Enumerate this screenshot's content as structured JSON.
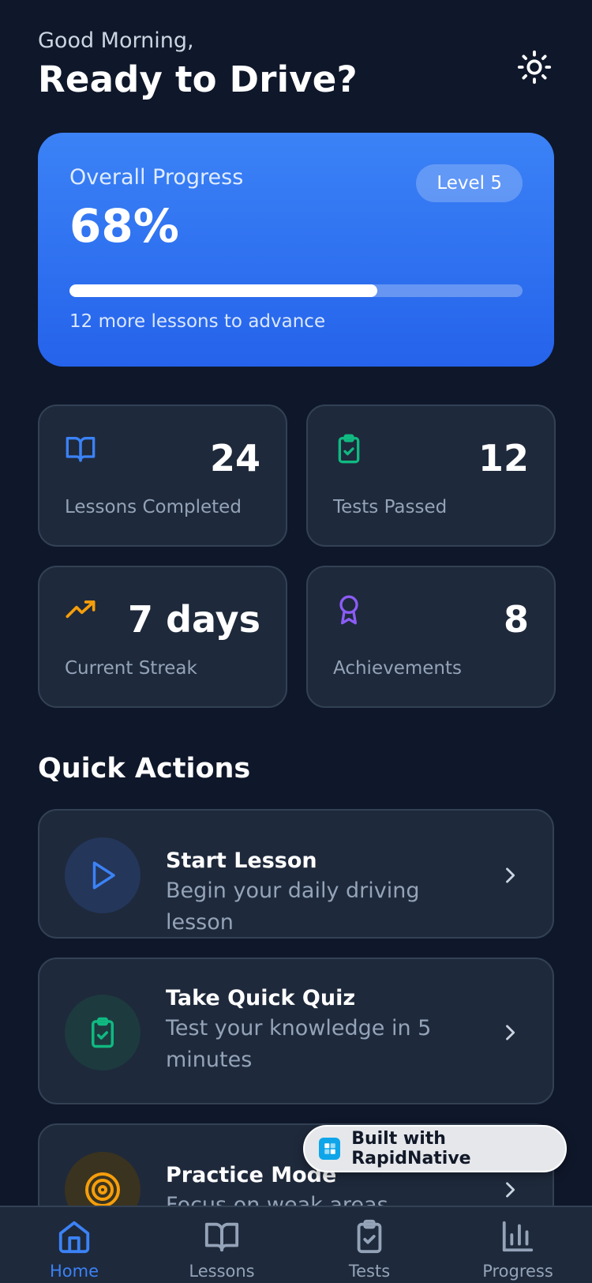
{
  "header": {
    "greeting": "Good Morning,",
    "headline": "Ready to Drive?"
  },
  "progress": {
    "label": "Overall Progress",
    "value_text": "68%",
    "percent": 68,
    "level": "Level 5",
    "subtext": "12 more lessons to advance"
  },
  "stats": [
    {
      "value": "24",
      "label": "Lessons Completed",
      "icon": "book-icon",
      "color": "#3b82f6"
    },
    {
      "value": "12",
      "label": "Tests Passed",
      "icon": "clipboard-check-icon",
      "color": "#10b981"
    },
    {
      "value": "7 days",
      "label": "Current Streak",
      "icon": "trending-up-icon",
      "color": "#f59e0b"
    },
    {
      "value": "8",
      "label": "Achievements",
      "icon": "award-icon",
      "color": "#8b5cf6"
    }
  ],
  "quick_actions": {
    "title": "Quick Actions",
    "items": [
      {
        "title": "Start Lesson",
        "description": "Begin your daily driving lesson",
        "icon": "play-icon",
        "color": "#3b82f6"
      },
      {
        "title": "Take Quick Quiz",
        "description": "Test your knowledge in 5 minutes",
        "icon": "clipboard-check-icon",
        "color": "#10b981"
      },
      {
        "title": "Practice Mode",
        "description": "Focus on weak areas",
        "icon": "target-icon",
        "color": "#f59e0b"
      }
    ]
  },
  "badge": {
    "text": "Built with RapidNative"
  },
  "tabs": [
    {
      "label": "Home",
      "icon": "home-icon",
      "active": true
    },
    {
      "label": "Lessons",
      "icon": "book-icon",
      "active": false
    },
    {
      "label": "Tests",
      "icon": "clipboard-check-icon",
      "active": false
    },
    {
      "label": "Progress",
      "icon": "bar-chart-icon",
      "active": false
    }
  ],
  "colors": {
    "background": "#0f172a",
    "card": "#1e293b",
    "accent": "#3b82f6"
  }
}
